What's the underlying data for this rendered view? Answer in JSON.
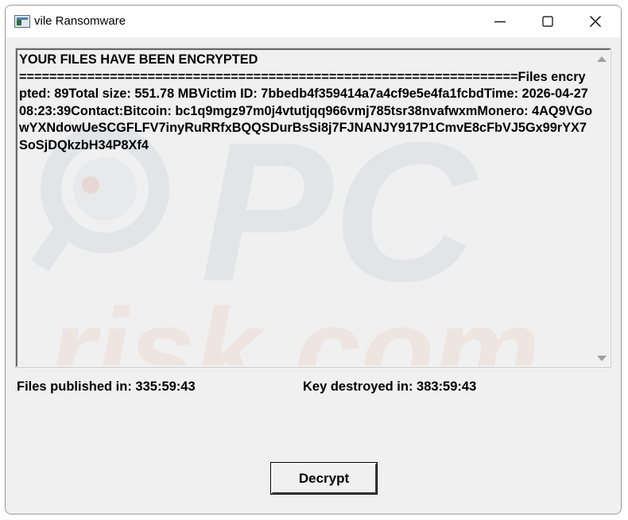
{
  "window": {
    "title": "vile Ransomware"
  },
  "titlebar": {
    "icons": [
      "app-icon",
      "minimize-icon",
      "maximize-icon",
      "close-icon"
    ]
  },
  "message": {
    "lines": [
      "YOUR FILES HAVE BEEN ENCRYPTED",
      "==================================================================Files encrypted: 89Total size: 551.78 MBVictim ID: 7bbedb4f359414a7a4cf9e5e4fa1fcbdTime: 2026-04-27 08:23:39Contact:Bitcoin: bc1q9mgz97m0j4vtutjqq966vmj785tsr38nvafwxmMonero: 4AQ9VGowYXNdowUeSCGFLFV7inyRuRRfxBQQSDurBsSi8j7FJNANJY917P1CmvE8cFbVJ5Gx99rYX7SoSjDQkzbH34P8Xf4"
    ]
  },
  "status": {
    "files_published": "Files published in: 335:59:43",
    "key_destroyed": "Key destroyed in: 383:59:43"
  },
  "actions": {
    "decrypt_label": "Decrypt"
  },
  "colors": {
    "window_bg": "#f0f0f0",
    "titlebar_bg": "#ffffff",
    "text": "#000000"
  }
}
